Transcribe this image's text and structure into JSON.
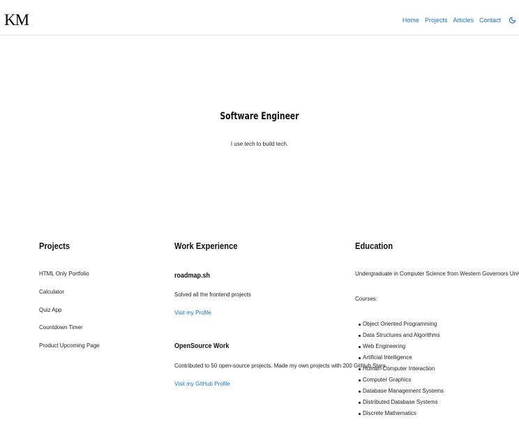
{
  "header": {
    "logo": "KM",
    "nav": [
      "Home",
      "Projects",
      "Articles",
      "Contact"
    ],
    "theme_icon": "moon-icon",
    "accent_color": "#1a73c9"
  },
  "hero": {
    "title": "Software Engineer",
    "subtitle": "I use tech to build tech."
  },
  "projects": {
    "title": "Projects",
    "items": [
      "HTML Only Portfolio",
      "Calculator",
      "Quiz App",
      "Countdown Timer",
      "Product Upcoming Page"
    ]
  },
  "work": {
    "title": "Work Experience",
    "jobs": [
      {
        "name": "roadmap.sh",
        "description": "Solved all the frontend projects",
        "link": "Visit my Profile"
      },
      {
        "name": "OpenSource Work",
        "description": "Contributed to 50 open-source projects. Made my own projects with 200 GitHub Stars.",
        "link": "Visit my GitHub Profile"
      }
    ]
  },
  "education": {
    "title": "Education",
    "degree": "Undergraduate in Computer Science from Western Governors University",
    "courses_label": "Courses:",
    "courses": [
      "Object Oriented Programming",
      "Data Structures and Algorithms",
      "Web Engineering",
      "Artificial Intelligence",
      "Human-Computer Interaction",
      "Computer Graphics",
      "Database Management Systems",
      "Distributed Database Systems",
      "Discrete Mathematics"
    ]
  }
}
